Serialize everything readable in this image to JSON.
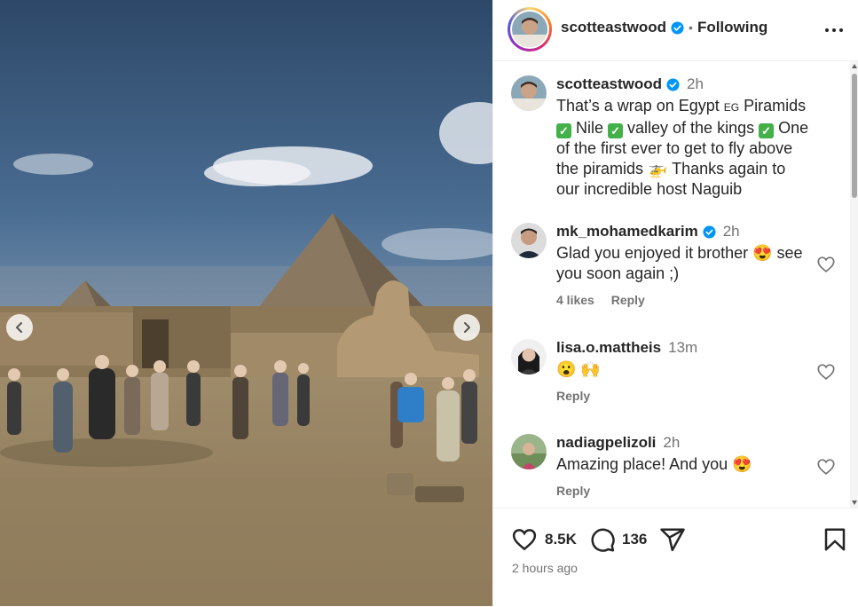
{
  "post": {
    "username": "scotteastwood",
    "follow_status": "Following",
    "dot": "•",
    "caption_time": "2h",
    "caption_parts": {
      "p1": "That’s a wrap on Egypt ",
      "flag": "EG",
      "p2": " Piramids ",
      "p3": " Nile ",
      "p4": " valley of the kings ",
      "p5": " One of the first ever to get to fly above the piramids ",
      "heli": "🚁",
      "p6": " Thanks again to our incredible host Naguib"
    }
  },
  "comments": [
    {
      "username": "mk_mohamedkarim",
      "time": "2h",
      "text": "Glad you enjoyed it brother 😍 see you soon again ;)",
      "likes": "4 likes",
      "reply": "Reply"
    },
    {
      "username": "lisa.o.mattheis",
      "time": "13m",
      "text": "😮 🙌",
      "reply": "Reply"
    },
    {
      "username": "nadiagpelizoli",
      "time": "2h",
      "text": "Amazing place! And you 😍",
      "reply": "Reply"
    }
  ],
  "actions": {
    "likes_count": "8.5K",
    "comments_count": "136",
    "timestamp": "2 hours ago"
  },
  "icons": [
    "prev-arrow-icon",
    "next-arrow-icon",
    "verified-icon",
    "more-icon",
    "heart-icon",
    "comment-icon",
    "share-icon",
    "bookmark-icon"
  ],
  "colors": {
    "verified": "#0095f6",
    "text": "#262626",
    "muted": "#737373",
    "check": "#43b049"
  }
}
